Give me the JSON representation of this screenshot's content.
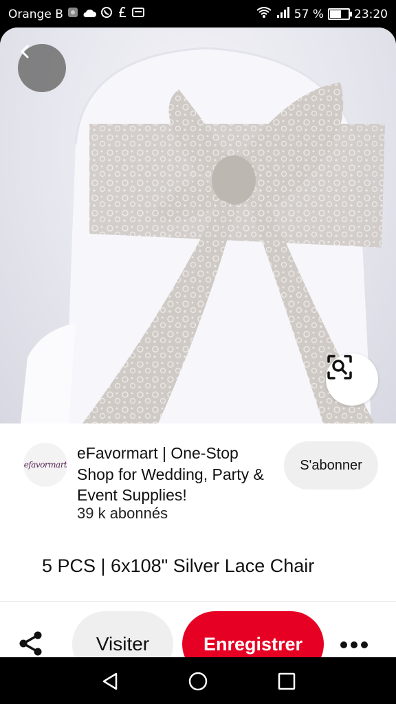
{
  "status_bar": {
    "carrier": "Orange B",
    "battery_percent": "57 %",
    "battery_level": 0.57,
    "time": "23:20"
  },
  "hero": {
    "back_icon": "chevron-left-icon",
    "lens_icon": "visual-search-icon"
  },
  "creator": {
    "avatar_text": "efavormart",
    "name": "eFavormart | One-Stop Shop for Wedding, Party & Event Supplies!",
    "followers": "39 k abonnés",
    "follow_label": "S'abonner"
  },
  "pin": {
    "title": "5 PCS | 6x108\" Silver Lace Chair"
  },
  "actions": {
    "share_icon": "share-icon",
    "visit_label": "Visiter",
    "save_label": "Enregistrer",
    "more_icon": "more-icon",
    "save_color": "#e60023"
  },
  "navbar": {
    "back_icon": "nav-back-icon",
    "home_icon": "nav-home-icon",
    "recent_icon": "nav-recent-icon"
  }
}
